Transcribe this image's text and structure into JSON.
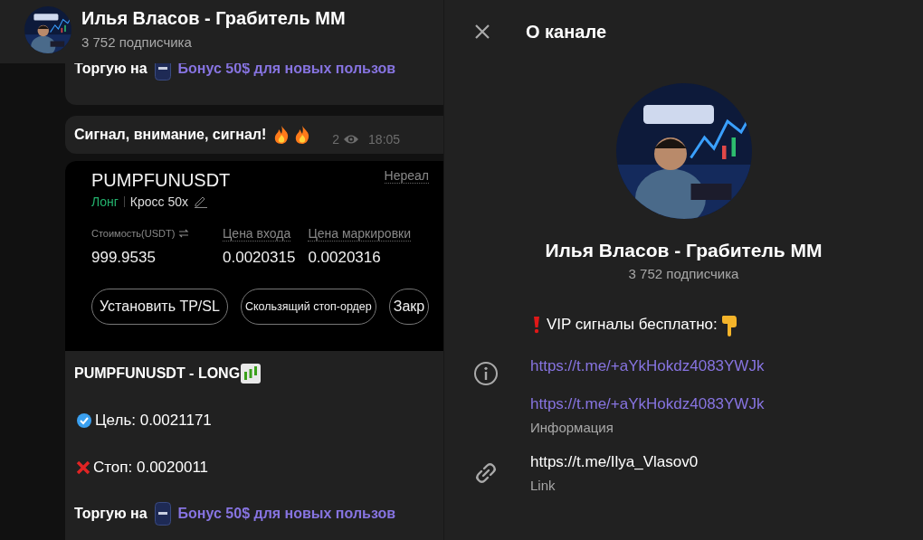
{
  "chat_header": {
    "title": "Илья Власов - Грабитель ММ",
    "subtitle": "3 752 подписчика"
  },
  "messages": [
    {
      "kind": "promo",
      "label": "Торгую на",
      "link": "Бонус 50$ для новых пользов"
    },
    {
      "kind": "text",
      "text": "Сигнал, внимание, сигнал!",
      "views": "2",
      "time": "18:05"
    },
    {
      "kind": "post",
      "screenshot": {
        "symbol": "PUMPFUNUSDT",
        "side": "Лонг",
        "margin": "Кросс 50x",
        "corner_label": "Нереал",
        "fields": [
          {
            "label": "Стоимость(USDT)",
            "value": "999.9535"
          },
          {
            "label": "Цена входа",
            "value": "0.0020315"
          },
          {
            "label": "Цена маркировки",
            "value": "0.0020316"
          }
        ],
        "buttons": [
          "Установить TP/SL",
          "Скользящий стоп-ордер",
          "Закр"
        ]
      },
      "lines": [
        {
          "kind": "title",
          "text": "PUMPFUNUSDT - LONG"
        },
        {
          "kind": "target",
          "text": "Цель: 0.0021171"
        },
        {
          "kind": "stop",
          "text": "Стоп: 0.0020011"
        },
        {
          "kind": "promo",
          "label": "Торгую на",
          "link": "Бонус 50$ для новых пользов"
        }
      ]
    }
  ],
  "channel_info": {
    "title": "О канале",
    "name": "Илья Власов - Грабитель ММ",
    "subscribers": "3 752 подписчика",
    "description": {
      "lines": [
        {
          "kind": "text",
          "text": "VIP сигналы бесплатно:"
        },
        {
          "kind": "link",
          "text": "https://t.me/+aYkHokdz4083YWJk"
        },
        {
          "kind": "link",
          "text": "https://t.me/+aYkHokdz4083YWJk"
        }
      ],
      "caption": "Информация"
    },
    "link": {
      "text": "https://t.me/Ilya_Vlasov0",
      "caption": "Link"
    }
  }
}
